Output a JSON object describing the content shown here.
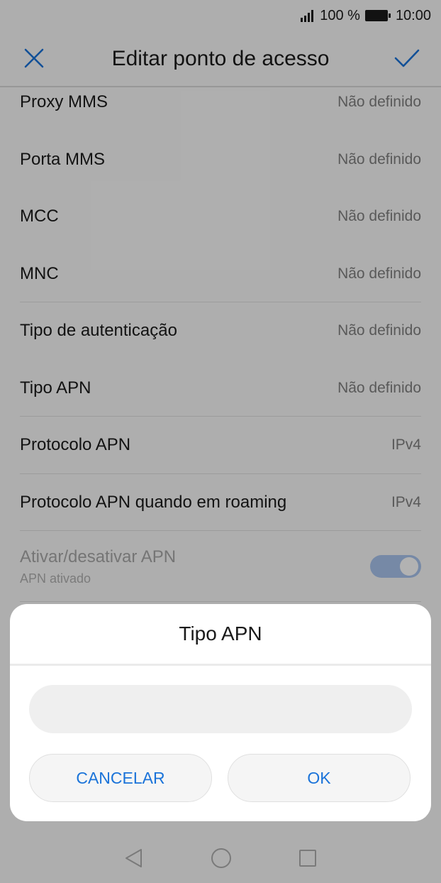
{
  "status": {
    "battery_percent": "100 %",
    "time": "10:00"
  },
  "header": {
    "title": "Editar ponto de acesso"
  },
  "settings": {
    "rows": [
      {
        "label": "Proxy MMS",
        "value": "Não definido"
      },
      {
        "label": "Porta MMS",
        "value": "Não definido"
      },
      {
        "label": "MCC",
        "value": "Não definido"
      },
      {
        "label": "MNC",
        "value": "Não definido"
      },
      {
        "label": "Tipo de autenticação",
        "value": "Não definido"
      },
      {
        "label": "Tipo APN",
        "value": "Não definido"
      },
      {
        "label": "Protocolo APN",
        "value": "IPv4"
      },
      {
        "label": "Protocolo APN quando em roaming",
        "value": "IPv4"
      }
    ],
    "toggle": {
      "label": "Ativar/desativar APN",
      "sublabel": "APN ativado",
      "state": "on"
    }
  },
  "dialog": {
    "title": "Tipo APN",
    "input_value": "",
    "cancel_label": "CANCELAR",
    "ok_label": "OK"
  },
  "colors": {
    "accent": "#1a73d9",
    "toggle_on": "#a9c4ee"
  },
  "icons": {
    "close": "close-icon",
    "confirm": "check-icon",
    "signal": "signal-icon",
    "battery": "battery-icon",
    "nav_back": "back-triangle-icon",
    "nav_home": "home-circle-icon",
    "nav_recents": "recents-square-icon"
  }
}
